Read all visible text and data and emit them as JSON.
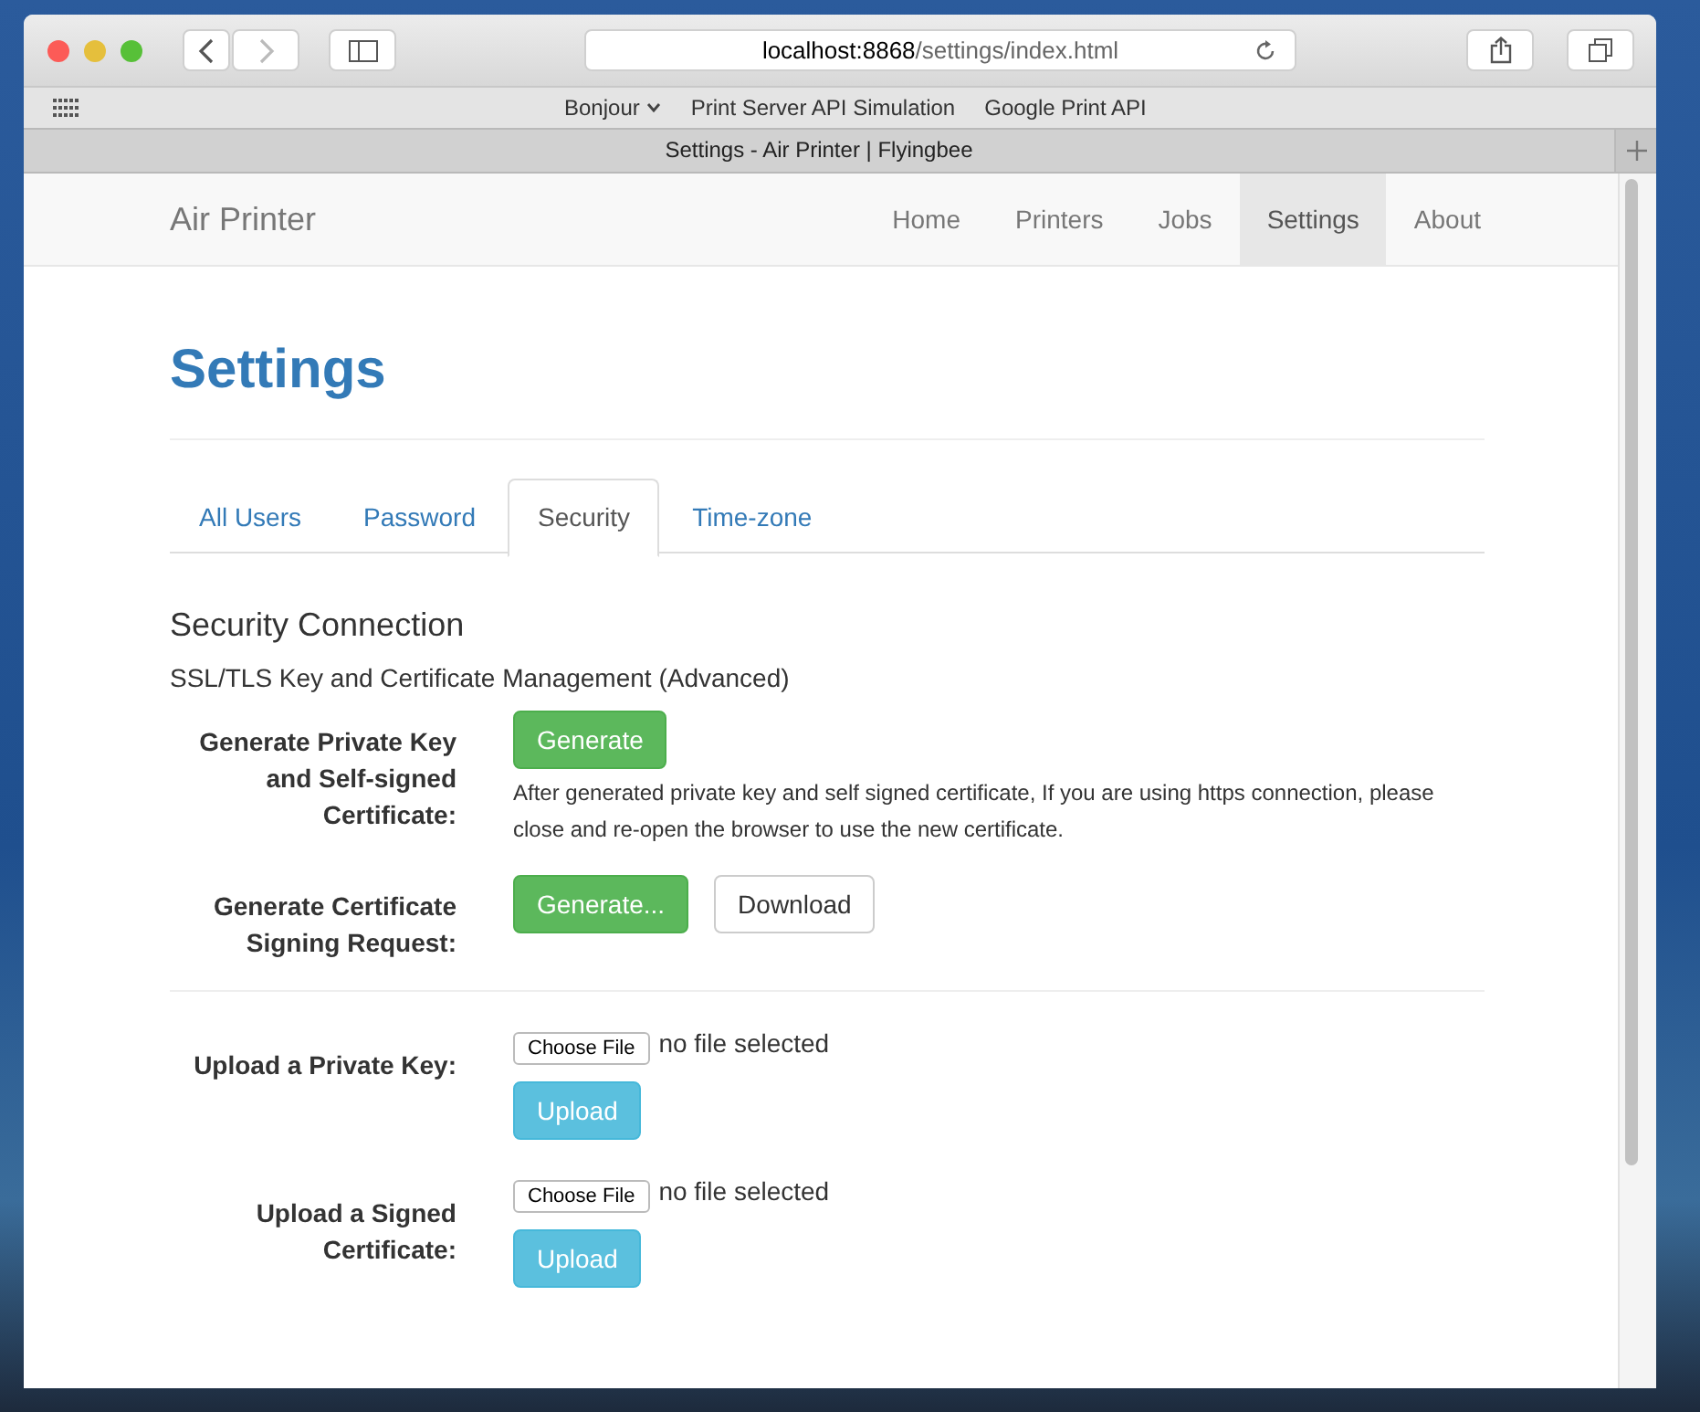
{
  "browser": {
    "url_host": "localhost:8868",
    "url_path": "/settings/index.html",
    "bookmarks": [
      {
        "label": "Bonjour",
        "kind": "menu"
      },
      {
        "label": "Print Server API Simulation",
        "kind": "link"
      },
      {
        "label": "Google Print API",
        "kind": "link"
      }
    ],
    "tab_title": "Settings - Air Printer | Flyingbee"
  },
  "navbar": {
    "brand": "Air Printer",
    "items": [
      {
        "label": "Home",
        "selected": false
      },
      {
        "label": "Printers",
        "selected": false
      },
      {
        "label": "Jobs",
        "selected": false
      },
      {
        "label": "Settings",
        "selected": true
      },
      {
        "label": "About",
        "selected": false
      }
    ]
  },
  "page": {
    "title": "Settings",
    "tabs": [
      {
        "label": "All Users",
        "selected": false
      },
      {
        "label": "Password",
        "selected": false
      },
      {
        "label": "Security",
        "selected": true
      },
      {
        "label": "Time-zone",
        "selected": false
      }
    ],
    "section_title": "Security Connection",
    "section_subtitle": "SSL/TLS Key and Certificate Management (Advanced)",
    "generate_rows": [
      {
        "label": "Generate Private Key and Self-signed Certificate:",
        "buttons": [
          {
            "label": "Generate",
            "kind": "primary"
          }
        ],
        "help": "After generated private key and self signed certificate, If you are using https connection, please close and re-open the browser to use the new certificate."
      },
      {
        "label": "Generate Certificate Signing Request:",
        "buttons": [
          {
            "label": "Generate...",
            "kind": "primary"
          },
          {
            "label": "Download",
            "kind": "secondary"
          }
        ]
      }
    ],
    "upload_rows": [
      {
        "label": "Upload a Private Key:",
        "file_button": "Choose File",
        "file_status": "no file selected",
        "upload": "Upload"
      },
      {
        "label": "Upload a Signed Certificate:",
        "file_button": "Choose File",
        "file_status": "no file selected",
        "upload": "Upload"
      }
    ]
  }
}
